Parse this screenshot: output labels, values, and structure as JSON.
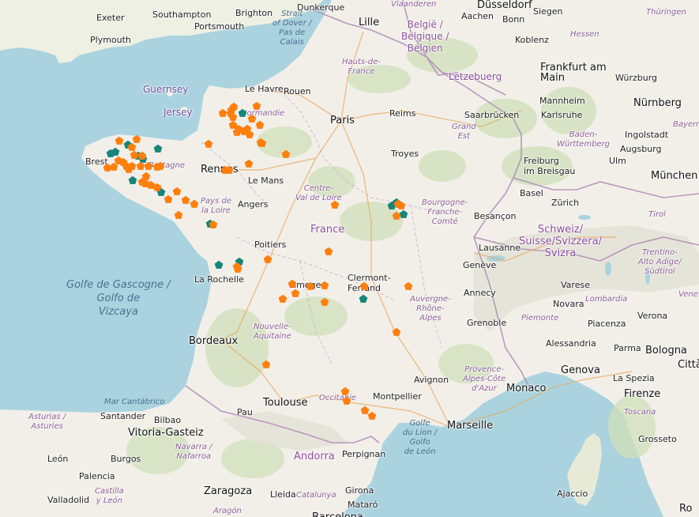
{
  "colors": {
    "sea": "#aad3df",
    "land": "#f2efe9",
    "forest": "#c8dcb0",
    "mountain": "#e6e0d4",
    "border": "#b28fb8",
    "marker_orange": "#ff7f0e",
    "marker_teal": "#16857a"
  },
  "labels": [
    {
      "id": "exeter",
      "text": "Exeter",
      "type": "city"
    },
    {
      "id": "southampton",
      "text": "Southampton",
      "type": "city"
    },
    {
      "id": "brighton",
      "text": "Brighton",
      "type": "city"
    },
    {
      "id": "dunkerque",
      "text": "Dunkerque",
      "type": "city"
    },
    {
      "id": "vlaanderen",
      "text": "Vlaanderen",
      "type": "region"
    },
    {
      "id": "dusseldorf",
      "text": "Düsseldorf",
      "type": "capital"
    },
    {
      "id": "thuringen",
      "text": "Thüringen",
      "type": "region"
    },
    {
      "id": "plymouth",
      "text": "Plymouth",
      "type": "city"
    },
    {
      "id": "portsmouth",
      "text": "Portsmouth",
      "type": "city"
    },
    {
      "id": "strait",
      "text": "Strait\nof Dover /\nPas de\nCalais",
      "type": "sea-small"
    },
    {
      "id": "lille",
      "text": "Lille",
      "type": "capital"
    },
    {
      "id": "aachen",
      "text": "Aachen",
      "type": "city"
    },
    {
      "id": "bonn",
      "text": "Bonn",
      "type": "city"
    },
    {
      "id": "siegen",
      "text": "Siegen",
      "type": "city"
    },
    {
      "id": "belgique",
      "text": "België /\nBelgique /\nBelgien",
      "type": "country"
    },
    {
      "id": "koblenz",
      "text": "Koblenz",
      "type": "city"
    },
    {
      "id": "hessen",
      "text": "Hessen",
      "type": "region"
    },
    {
      "id": "hautsdefrance",
      "text": "Hauts-de-\nFrance",
      "type": "region"
    },
    {
      "id": "frankfurt",
      "text": "Frankfurt am\nMain",
      "type": "capital"
    },
    {
      "id": "guernsey",
      "text": "Guernsey",
      "type": "island"
    },
    {
      "id": "lehavre",
      "text": "Le Havre",
      "type": "city"
    },
    {
      "id": "rouen",
      "text": "Rouen",
      "type": "city"
    },
    {
      "id": "letzebuerg",
      "text": "Lëtzebuerg",
      "type": "country"
    },
    {
      "id": "wurzburg",
      "text": "Würzburg",
      "type": "city"
    },
    {
      "id": "jersey",
      "text": "Jersey",
      "type": "island"
    },
    {
      "id": "mannheim",
      "text": "Mannheim",
      "type": "city"
    },
    {
      "id": "nurnberg",
      "text": "Nürnberg",
      "type": "capital"
    },
    {
      "id": "normandie",
      "text": "Normandie",
      "type": "region"
    },
    {
      "id": "reims",
      "text": "Reims",
      "type": "city"
    },
    {
      "id": "saarbrucken",
      "text": "Saarbrücken",
      "type": "city"
    },
    {
      "id": "karlsruhe",
      "text": "Karlsruhe",
      "type": "city"
    },
    {
      "id": "paris",
      "text": "Paris",
      "type": "capital"
    },
    {
      "id": "bayern",
      "text": "Bayern",
      "type": "region"
    },
    {
      "id": "grandest",
      "text": "Grand\nEst",
      "type": "region"
    },
    {
      "id": "badenw",
      "text": "Baden-\nWürttemberg",
      "type": "region"
    },
    {
      "id": "ingolstadt",
      "text": "Ingolstadt",
      "type": "city"
    },
    {
      "id": "brest",
      "text": "Brest",
      "type": "city"
    },
    {
      "id": "augsburg",
      "text": "Augsburg",
      "type": "city"
    },
    {
      "id": "troyes",
      "text": "Troyes",
      "type": "city"
    },
    {
      "id": "freiburg",
      "text": "Freiburg\nim Breisgau",
      "type": "city"
    },
    {
      "id": "ulm",
      "text": "Ulm",
      "type": "city"
    },
    {
      "id": "rennes",
      "text": "Rennes",
      "type": "capital"
    },
    {
      "id": "bretagne",
      "text": "Bretagne",
      "type": "region"
    },
    {
      "id": "munchen",
      "text": "München",
      "type": "capital"
    },
    {
      "id": "lemans",
      "text": "Le Mans",
      "type": "city"
    },
    {
      "id": "centre",
      "text": "Centre-\nVal de Loire",
      "type": "region"
    },
    {
      "id": "basel",
      "text": "Basel",
      "type": "city"
    },
    {
      "id": "angers",
      "text": "Angers",
      "type": "city"
    },
    {
      "id": "paysdelaloire",
      "text": "Pays de\nla Loire",
      "type": "region"
    },
    {
      "id": "bourgogne",
      "text": "Bourgogne-\nFranche-\nComté",
      "type": "region"
    },
    {
      "id": "zurich",
      "text": "Zürich",
      "type": "city"
    },
    {
      "id": "tirol",
      "text": "Tirol",
      "type": "region"
    },
    {
      "id": "besancon",
      "text": "Besançon",
      "type": "city"
    },
    {
      "id": "france",
      "text": "France",
      "type": "country-big"
    },
    {
      "id": "schweiz",
      "text": "Schweiz/\nSuisse/Svizzera/\nSvizra",
      "type": "country-big"
    },
    {
      "id": "poitiers",
      "text": "Poitiers",
      "type": "city"
    },
    {
      "id": "lausanne",
      "text": "Lausanne",
      "type": "city"
    },
    {
      "id": "trentino",
      "text": "Trentino-\nAlto Adige/\nSüdtirol",
      "type": "region"
    },
    {
      "id": "geneve",
      "text": "Genève",
      "type": "city"
    },
    {
      "id": "golfe",
      "text": "Golfe de Gascogne /\nGolfo de\nVizcaya",
      "type": "sea"
    },
    {
      "id": "larochelle",
      "text": "La Rochelle",
      "type": "city"
    },
    {
      "id": "clermont",
      "text": "Clermont-\nFerrand",
      "type": "city"
    },
    {
      "id": "limoges",
      "text": "Limoges",
      "type": "city"
    },
    {
      "id": "annecy",
      "text": "Annecy",
      "type": "city"
    },
    {
      "id": "varese",
      "text": "Varese",
      "type": "city"
    },
    {
      "id": "novara",
      "text": "Novara",
      "type": "city"
    },
    {
      "id": "lombardia",
      "text": "Lombardia",
      "type": "region"
    },
    {
      "id": "venet",
      "text": "Venet",
      "type": "region"
    },
    {
      "id": "auvergne",
      "text": "Auvergne-\nRhône-\nAlpes",
      "type": "region"
    },
    {
      "id": "verona",
      "text": "Verona",
      "type": "city"
    },
    {
      "id": "nouvelleaq",
      "text": "Nouvelle-\nAquitaine",
      "type": "region"
    },
    {
      "id": "grenoble",
      "text": "Grenoble",
      "type": "city"
    },
    {
      "id": "piemonte",
      "text": "Piemonte",
      "type": "region"
    },
    {
      "id": "piacenza",
      "text": "Piacenza",
      "type": "city"
    },
    {
      "id": "bordeaux",
      "text": "Bordeaux",
      "type": "capital"
    },
    {
      "id": "alessandria",
      "text": "Alessandria",
      "type": "city"
    },
    {
      "id": "parma",
      "text": "Parma",
      "type": "city"
    },
    {
      "id": "bologna",
      "text": "Bologna",
      "type": "capital"
    },
    {
      "id": "citta",
      "text": "Città",
      "type": "capital"
    },
    {
      "id": "genova",
      "text": "Genova",
      "type": "capital"
    },
    {
      "id": "provence",
      "text": "Provence-\nAlpes-Côte\nd'Azur",
      "type": "region"
    },
    {
      "id": "avignon",
      "text": "Avignon",
      "type": "city"
    },
    {
      "id": "laspezia",
      "text": "La Spezia",
      "type": "city"
    },
    {
      "id": "monaco",
      "text": "Monaco",
      "type": "capital"
    },
    {
      "id": "marcantabrico",
      "text": "Mar Cantábrico",
      "type": "sea-small"
    },
    {
      "id": "firenze",
      "text": "Firenze",
      "type": "capital"
    },
    {
      "id": "occitanie",
      "text": "Occitanie",
      "type": "region"
    },
    {
      "id": "montpellier",
      "text": "Montpellier",
      "type": "city"
    },
    {
      "id": "toulouse",
      "text": "Toulouse",
      "type": "capital"
    },
    {
      "id": "asturias",
      "text": "Asturias /\nAsturies",
      "type": "region"
    },
    {
      "id": "santander",
      "text": "Santander",
      "type": "city"
    },
    {
      "id": "bilbao",
      "text": "Bilbao",
      "type": "city"
    },
    {
      "id": "pau",
      "text": "Pau",
      "type": "city"
    },
    {
      "id": "golfedulion",
      "text": "Golfe\ndu Lion /\nGolfo\nde León",
      "type": "sea-small"
    },
    {
      "id": "toscana",
      "text": "Toscana",
      "type": "region"
    },
    {
      "id": "marseille",
      "text": "Marseille",
      "type": "capital"
    },
    {
      "id": "vitoria",
      "text": "Vitoria-Gasteiz",
      "type": "capital"
    },
    {
      "id": "grosseto",
      "text": "Grosseto",
      "type": "city"
    },
    {
      "id": "navarra",
      "text": "Navarra /\nNafarroa",
      "type": "region"
    },
    {
      "id": "perpignan",
      "text": "Perpignan",
      "type": "city"
    },
    {
      "id": "castilla",
      "text": "Castilla\ny León",
      "type": "region"
    },
    {
      "id": "leon",
      "text": "León",
      "type": "city"
    },
    {
      "id": "burgos",
      "text": "Burgos",
      "type": "city"
    },
    {
      "id": "andorra",
      "text": "Andorra",
      "type": "country-big"
    },
    {
      "id": "palencia",
      "text": "Palencia",
      "type": "city"
    },
    {
      "id": "girona",
      "text": "Girona",
      "type": "city"
    },
    {
      "id": "zaragoza",
      "text": "Zaragoza",
      "type": "capital"
    },
    {
      "id": "lleida",
      "text": "Lleida",
      "type": "city"
    },
    {
      "id": "catalunya",
      "text": "Catalunya",
      "type": "region"
    },
    {
      "id": "ajaccio",
      "text": "Ajaccio",
      "type": "city"
    },
    {
      "id": "valladolid",
      "text": "Valladolid",
      "type": "city"
    },
    {
      "id": "aragon",
      "text": "Aragón",
      "type": "region"
    },
    {
      "id": "mataro",
      "text": "Mataró",
      "type": "city"
    },
    {
      "id": "barcelona",
      "text": "Barcelona",
      "type": "capital"
    },
    {
      "id": "ro",
      "text": "Ro",
      "type": "capital"
    }
  ],
  "markers": [
    {
      "c": "t"
    },
    {
      "c": "t"
    },
    {
      "c": "t"
    },
    {
      "c": "t"
    },
    {
      "c": "t"
    },
    {
      "c": "t"
    },
    {
      "c": "t"
    },
    {
      "c": "t"
    },
    {
      "c": "t"
    },
    {
      "c": "t"
    },
    {
      "c": "t"
    },
    {
      "c": "t"
    },
    {
      "c": "t"
    },
    {
      "c": "t"
    },
    {
      "c": "t"
    },
    {
      "c": "t"
    },
    {
      "c": "o"
    },
    {
      "c": "o"
    },
    {
      "c": "o"
    },
    {
      "c": "o"
    },
    {
      "c": "o"
    },
    {
      "c": "o"
    },
    {
      "c": "o"
    },
    {
      "c": "o"
    },
    {
      "c": "o"
    },
    {
      "c": "o"
    },
    {
      "c": "o"
    },
    {
      "c": "o"
    },
    {
      "c": "o"
    },
    {
      "c": "o"
    },
    {
      "c": "o"
    },
    {
      "c": "o"
    },
    {
      "c": "o"
    },
    {
      "c": "o"
    },
    {
      "c": "o"
    },
    {
      "c": "o"
    },
    {
      "c": "o"
    },
    {
      "c": "o"
    },
    {
      "c": "o"
    },
    {
      "c": "o"
    },
    {
      "c": "o"
    },
    {
      "c": "o"
    },
    {
      "c": "o"
    },
    {
      "c": "o"
    },
    {
      "c": "o"
    },
    {
      "c": "o"
    },
    {
      "c": "o"
    },
    {
      "c": "o"
    },
    {
      "c": "o"
    },
    {
      "c": "o"
    },
    {
      "c": "o"
    },
    {
      "c": "o"
    },
    {
      "c": "o"
    },
    {
      "c": "o"
    },
    {
      "c": "o"
    },
    {
      "c": "o"
    },
    {
      "c": "o"
    },
    {
      "c": "o"
    },
    {
      "c": "o"
    },
    {
      "c": "o"
    },
    {
      "c": "o"
    },
    {
      "c": "o"
    },
    {
      "c": "o"
    },
    {
      "c": "o"
    },
    {
      "c": "o"
    },
    {
      "c": "o"
    },
    {
      "c": "o"
    },
    {
      "c": "o"
    },
    {
      "c": "o"
    },
    {
      "c": "o"
    },
    {
      "c": "o"
    },
    {
      "c": "o"
    },
    {
      "c": "o"
    },
    {
      "c": "o"
    },
    {
      "c": "o"
    },
    {
      "c": "o"
    },
    {
      "c": "o"
    },
    {
      "c": "o"
    },
    {
      "c": "o"
    },
    {
      "c": "o"
    },
    {
      "c": "o"
    },
    {
      "c": "o"
    },
    {
      "c": "o"
    },
    {
      "c": "o"
    },
    {
      "c": "o"
    },
    {
      "c": "o"
    },
    {
      "c": "o"
    },
    {
      "c": "o"
    },
    {
      "c": "o"
    },
    {
      "c": "o"
    },
    {
      "c": "o"
    },
    {
      "c": "o"
    }
  ]
}
